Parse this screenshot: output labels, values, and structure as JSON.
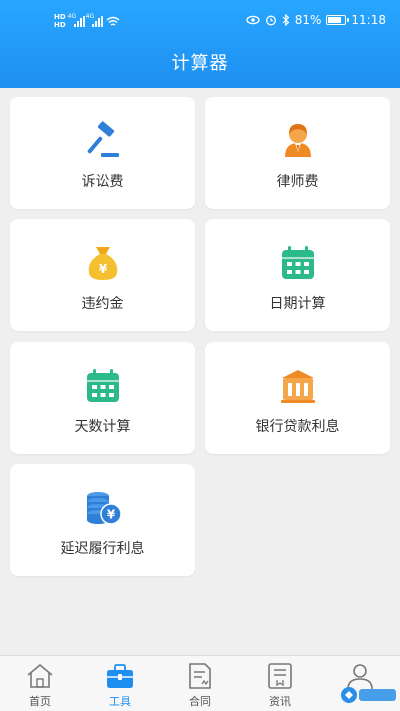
{
  "status_bar": {
    "carrier_hd_1": "HD",
    "carrier_hd_2": "HD",
    "net_1": "4G",
    "net_2": "4G",
    "battery": "81%",
    "time": "11:18"
  },
  "header": {
    "title": "计算器"
  },
  "tools": [
    {
      "label": "诉讼费",
      "icon": "gavel-icon",
      "color": "#2e7fd8"
    },
    {
      "label": "律师费",
      "icon": "lawyer-icon",
      "color": "#f08a24"
    },
    {
      "label": "违约金",
      "icon": "money-bag-icon",
      "color": "#f5b820"
    },
    {
      "label": "日期计算",
      "icon": "calendar-icon",
      "color": "#2cba8a"
    },
    {
      "label": "天数计算",
      "icon": "calendar-icon",
      "color": "#2cba8a"
    },
    {
      "label": "银行贷款利息",
      "icon": "bank-icon",
      "color": "#f08a24"
    },
    {
      "label": "延迟履行利息",
      "icon": "coins-icon",
      "color": "#2e7fd8"
    }
  ],
  "bottom_nav": [
    {
      "label": "首页",
      "icon": "home-icon",
      "active": false
    },
    {
      "label": "工具",
      "icon": "toolbox-icon",
      "active": true
    },
    {
      "label": "合同",
      "icon": "contract-icon",
      "active": false
    },
    {
      "label": "资讯",
      "icon": "news-icon",
      "active": false
    },
    {
      "label": "",
      "icon": "profile-icon",
      "active": false
    }
  ],
  "colors": {
    "primary": "#1e8ff0",
    "background": "#efefef"
  }
}
